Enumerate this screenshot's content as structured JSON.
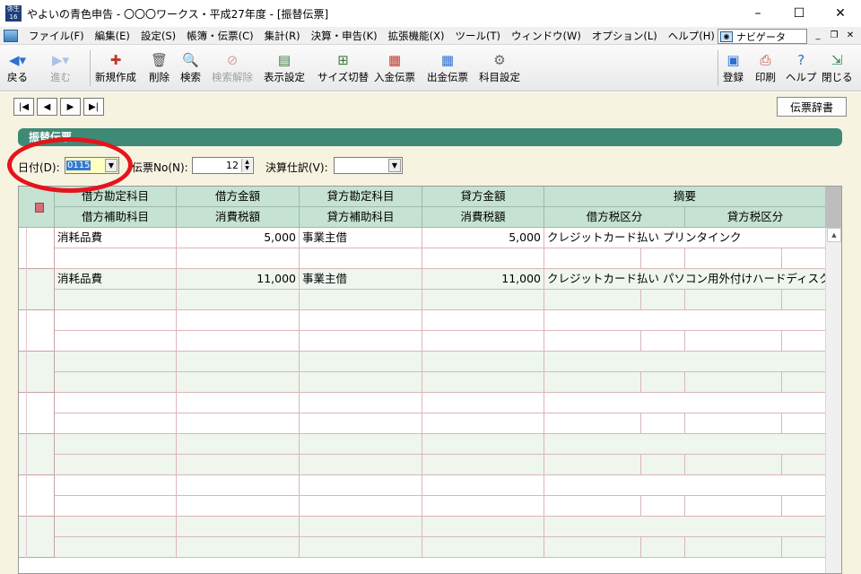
{
  "window": {
    "title": "やよいの青色申告 - 〇〇〇ワークス・平成27年度 - [振替伝票]",
    "app_icon_text": "弥生16",
    "controls": {
      "minimize": "–",
      "maximize": "☐",
      "close": "✕"
    }
  },
  "menu": {
    "items": [
      "ファイル(F)",
      "編集(E)",
      "設定(S)",
      "帳簿・伝票(C)",
      "集計(R)",
      "決算・申告(K)",
      "拡張機能(X)",
      "ツール(T)",
      "ウィンドウ(W)",
      "オプション(L)",
      "ヘルプ(H)"
    ],
    "navigator_label": "ナビゲータ",
    "mdi": {
      "minimize": "_",
      "restore": "❐",
      "close": "✕"
    }
  },
  "toolbar": {
    "back": "戻る",
    "forward": "進む",
    "new": "新規作成",
    "delete": "削除",
    "search": "検索",
    "search_clear": "検索解除",
    "display_settings": "表示設定",
    "size_toggle": "サイズ切替",
    "deposit_slip": "入金伝票",
    "payment_slip": "出金伝票",
    "account_settings": "科目設定",
    "register": "登録",
    "print": "印刷",
    "help": "ヘルプ",
    "close": "閉じる"
  },
  "colors": {
    "header_green": "#c5e2d2",
    "section_bar": "#3e8a76",
    "highlight_red": "#e5141c",
    "background": "#f7f3e1"
  },
  "workarea": {
    "dict_button": "伝票辞書",
    "section_title": "振替伝票",
    "fields": {
      "date_label": "日付(D):",
      "date_value": "0115",
      "slip_no_label": "伝票No(N):",
      "slip_no_value": "12",
      "closing_label": "決算仕訳(V):",
      "closing_value": ""
    }
  },
  "grid": {
    "headers_top": [
      "借方勘定科目",
      "借方金額",
      "貸方勘定科目",
      "貸方金額",
      "摘要"
    ],
    "headers_bottom": [
      "借方補助科目",
      "消費税額",
      "貸方補助科目",
      "消費税額",
      "借方税区分",
      "貸方税区分"
    ],
    "rows": [
      {
        "debit_account": "消耗品費",
        "debit_amount": "5,000",
        "credit_account": "事業主借",
        "credit_amount": "5,000",
        "description": "クレジットカード払い プリンタインク"
      },
      {
        "debit_account": "消耗品費",
        "debit_amount": "11,000",
        "credit_account": "事業主借",
        "credit_amount": "11,000",
        "description": "クレジットカード払い パソコン用外付けハードディスク"
      }
    ]
  }
}
